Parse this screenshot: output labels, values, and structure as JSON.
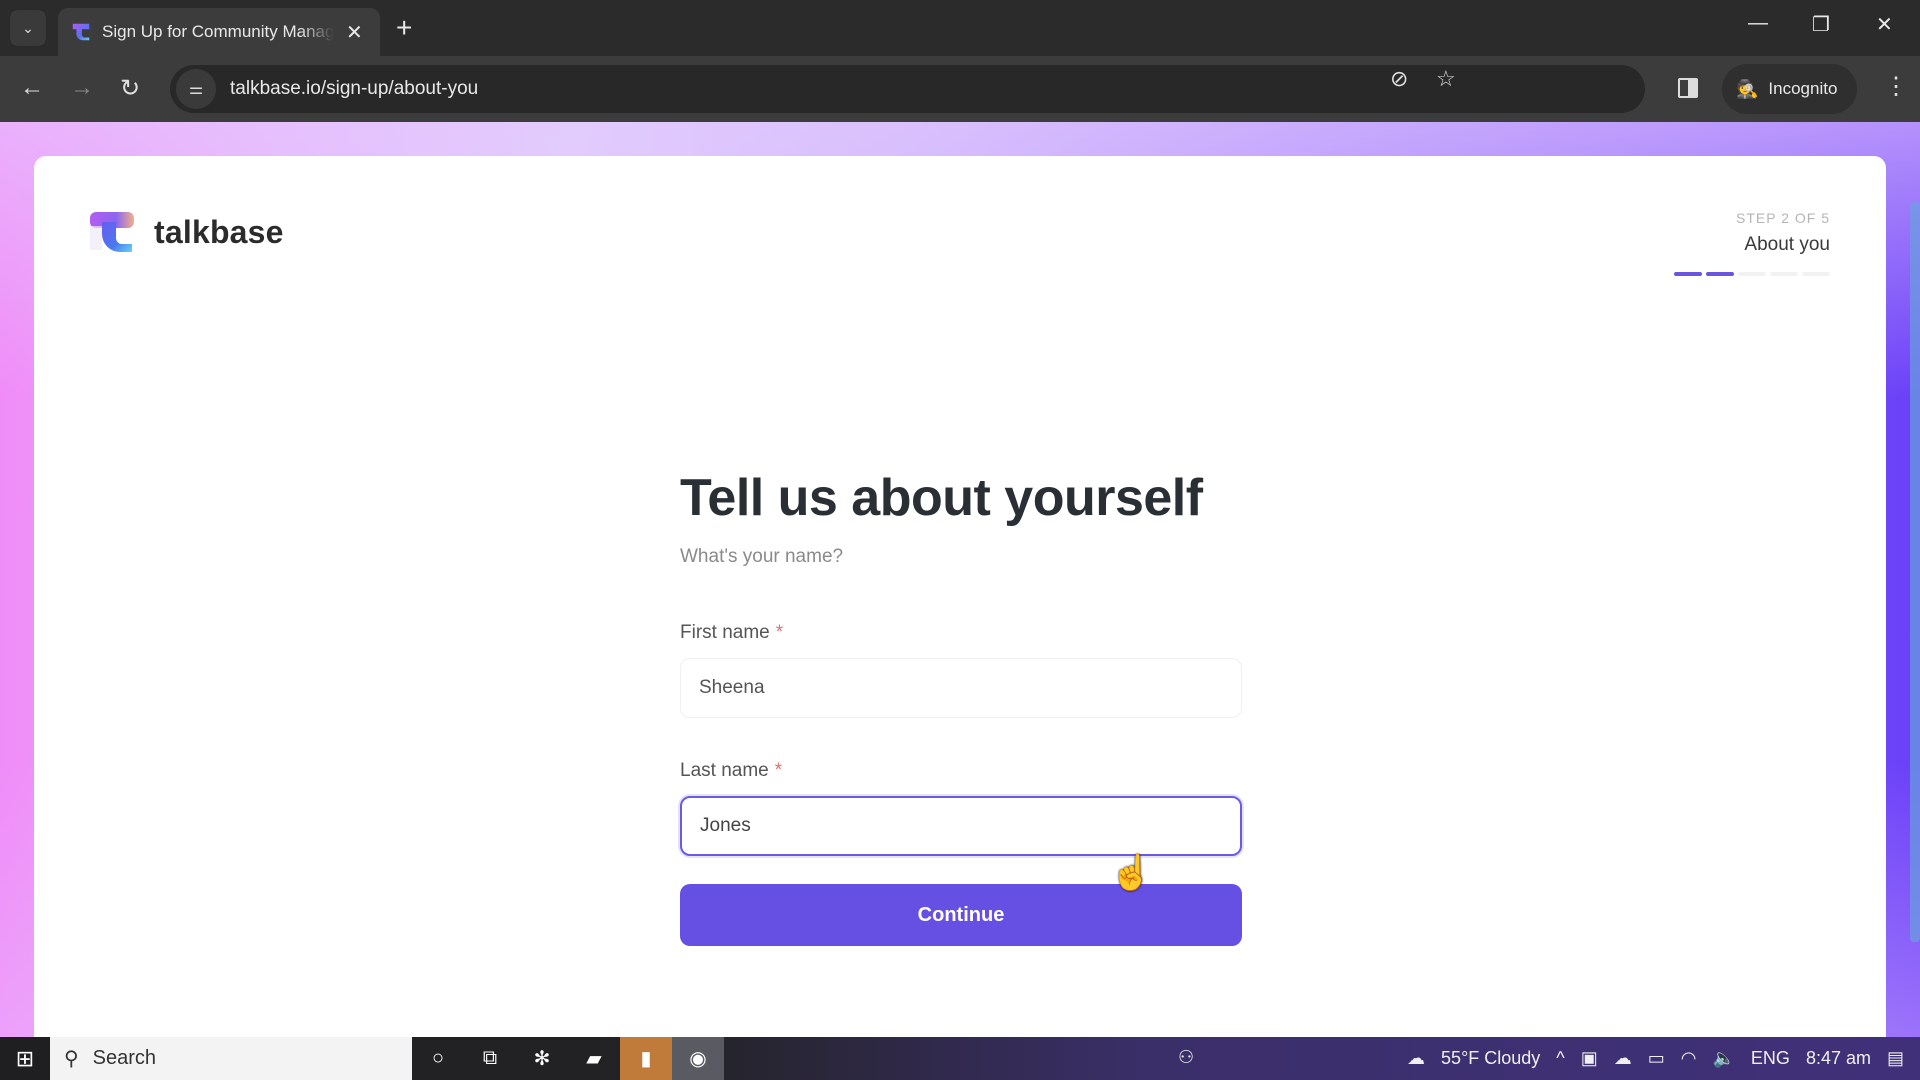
{
  "browser": {
    "tab_title": "Sign Up for Community Managers",
    "url": "talkbase.io/sign-up/about-you",
    "profile_label": "Incognito",
    "icons": {
      "tab_list": "chevron-down-icon",
      "close_tab": "close-icon",
      "new_tab": "plus-icon",
      "back": "arrow-left-icon",
      "forward": "arrow-right-icon",
      "reload": "reload-icon",
      "site_info": "tune-icon",
      "tracking": "eye-off-icon",
      "bookmark": "star-icon",
      "side_panel": "side-panel-icon",
      "incognito": "incognito-icon",
      "menu": "more-vertical-icon"
    }
  },
  "page": {
    "brand_name": "talkbase",
    "step": {
      "count_label": "STEP 2 OF 5",
      "current": 2,
      "total": 5,
      "name": "About you"
    },
    "heading": "Tell us about yourself",
    "subheading": "What's your name?",
    "fields": [
      {
        "label": "First name",
        "required_mark": "*",
        "value": "Sheena",
        "focused": false
      },
      {
        "label": "Last name",
        "required_mark": "*",
        "value": "Jones",
        "focused": true
      }
    ],
    "continue_label": "Continue",
    "accent_color": "#6650e4"
  },
  "taskbar": {
    "search_label": "Search",
    "weather": "55°F  Cloudy",
    "language": "ENG",
    "time": "8:47 am"
  }
}
